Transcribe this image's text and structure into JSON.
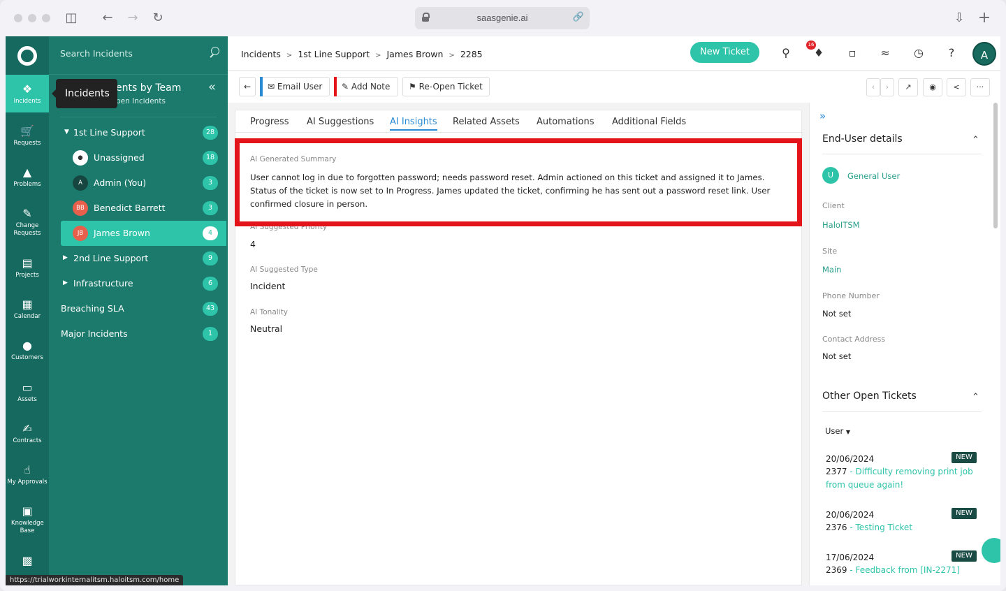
{
  "browser": {
    "url": "saasgenie.ai"
  },
  "rail": {
    "items": [
      {
        "label": "Incidents",
        "icon": "incidents-icon"
      },
      {
        "label": "Requests",
        "icon": "cart-icon"
      },
      {
        "label": "Problems",
        "icon": "warning-icon"
      },
      {
        "label": "Change Requests",
        "icon": "edit-icon"
      },
      {
        "label": "Projects",
        "icon": "projects-icon"
      },
      {
        "label": "Calendar",
        "icon": "calendar-icon"
      },
      {
        "label": "Customers",
        "icon": "person-icon"
      },
      {
        "label": "Assets",
        "icon": "laptop-icon"
      },
      {
        "label": "Contracts",
        "icon": "contract-icon"
      },
      {
        "label": "My Approvals",
        "icon": "thumbs-up-icon"
      },
      {
        "label": "Knowledge Base",
        "icon": "knowledge-icon"
      }
    ]
  },
  "sidebar": {
    "search_placeholder": "Search Incidents",
    "title": "Incidents by Team",
    "title_visible": "ents by Team",
    "subtitle_visible": "pen Incidents",
    "tooltip": "Incidents",
    "items": [
      {
        "label": "1st Line Support",
        "count": "28"
      },
      {
        "label": "Unassigned",
        "count": "18"
      },
      {
        "label": "Admin (You)",
        "count": "3",
        "initials": "A"
      },
      {
        "label": "Benedict Barrett",
        "count": "3",
        "initials": "BB"
      },
      {
        "label": "James Brown",
        "count": "4",
        "initials": "JB"
      },
      {
        "label": "2nd Line Support",
        "count": "9"
      },
      {
        "label": "Infrastructure",
        "count": "6"
      },
      {
        "label": "Breaching SLA",
        "count": "43"
      },
      {
        "label": "Major Incidents",
        "count": "1"
      }
    ],
    "status_url": "https://trialworkinternalitsm.haloitsm.com/home"
  },
  "header": {
    "breadcrumb": [
      "Incidents",
      "1st Line Support",
      "James Brown",
      "2285"
    ],
    "new_ticket": "New Ticket",
    "notification_count": "16",
    "avatar": "A"
  },
  "toolbar": {
    "email_user": "Email User",
    "add_note": "Add Note",
    "reopen": "Re-Open Ticket",
    "accent_email": "#2a8bd4",
    "accent_note": "#e4141b"
  },
  "tabs": [
    "Progress",
    "AI Suggestions",
    "AI Insights",
    "Related Assets",
    "Automations",
    "Additional Fields"
  ],
  "insights": {
    "summary_label": "AI Generated Summary",
    "summary_text": "User cannot log in due to forgotten password; needs password reset. Admin actioned on this ticket and assigned it to James. Status of the ticket is now set to In Progress. James updated the ticket, confirming he has sent out a password reset link. User confirmed closure in person.",
    "priority_label": "AI Suggested Priority",
    "priority_value": "4",
    "type_label": "AI Suggested Type",
    "type_value": "Incident",
    "tonality_label": "AI Tonality",
    "tonality_value": "Neutral"
  },
  "details": {
    "section_title": "End-User details",
    "user_initial": "U",
    "user_name": "General User",
    "client_label": "Client",
    "client_value": "HaloITSM",
    "site_label": "Site",
    "site_value": "Main",
    "phone_label": "Phone Number",
    "phone_value": "Not set",
    "address_label": "Contact Address",
    "address_value": "Not set",
    "other_title": "Other Open Tickets",
    "filter": "User",
    "tickets": [
      {
        "date": "20/06/2024",
        "id": "2377",
        "title": "Difficulty removing print job from queue again!",
        "badge": "NEW"
      },
      {
        "date": "20/06/2024",
        "id": "2376",
        "title": "Testing Ticket",
        "badge": "NEW"
      },
      {
        "date": "17/06/2024",
        "id": "2369",
        "title": "Feedback from [IN-2271]",
        "badge": "NEW"
      }
    ]
  }
}
